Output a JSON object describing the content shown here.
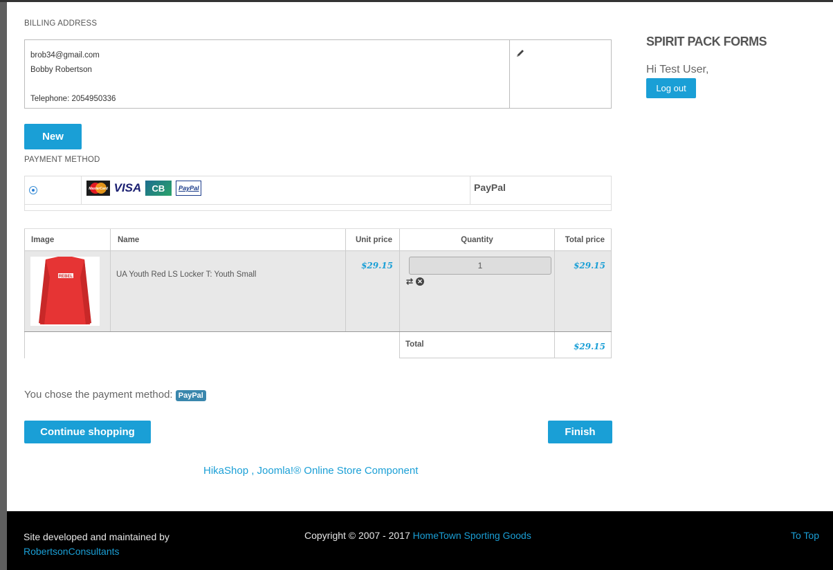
{
  "billing": {
    "section_label": "BILLING ADDRESS",
    "email": "brob34@gmail.com",
    "name": "Bobby Robertson",
    "telephone": "Telephone: 2054950336",
    "new_button": "New"
  },
  "payment": {
    "section_label": "PAYMENT METHOD",
    "method_name": "PayPal",
    "cards": [
      {
        "name": "mastercard-logo",
        "label": "MasterCard"
      },
      {
        "name": "visa-logo",
        "label": "VISA"
      },
      {
        "name": "cb-logo",
        "label": "CB"
      },
      {
        "name": "paypal-logo",
        "label": "PayPal"
      }
    ],
    "chosen_text": "You chose the payment method:",
    "chosen_badge": "PayPal"
  },
  "cart": {
    "headers": {
      "image": "Image",
      "name": "Name",
      "unit_price": "Unit price",
      "quantity": "Quantity",
      "total_price": "Total price"
    },
    "items": [
      {
        "name": "UA Youth Red LS Locker T: Youth Small",
        "unit_price": "$29.15",
        "quantity": "1",
        "total_price": "$29.15",
        "shirt_text": "REBEL"
      }
    ],
    "total_label": "Total",
    "total_value": "$29.15"
  },
  "buttons": {
    "continue_shopping": "Continue shopping",
    "finish": "Finish"
  },
  "powered_by": "HikaShop , Joomla!® Online Store Component",
  "sidebar": {
    "title": "SPIRIT PACK FORMS",
    "greeting": "Hi Test User,",
    "logout": "Log out"
  },
  "footer": {
    "developed_by": "Site developed and maintained by",
    "developer_link": "RobertsonConsultants",
    "copyright": "Copyright © 2007 - 2017",
    "company_link": "HomeTown Sporting Goods",
    "to_top": "To Top"
  },
  "colors": {
    "accent": "#1a9fd6",
    "footer_bg": "#000000",
    "row_bg": "#e8e8e8"
  }
}
